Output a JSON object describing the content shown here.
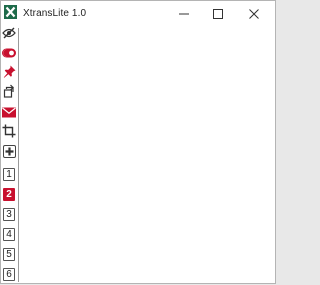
{
  "window": {
    "title": "XtransLite 1.0",
    "icon": "app-x-icon",
    "controls": [
      "minimize-icon",
      "maximize-icon",
      "close-icon"
    ]
  },
  "toolbar": {
    "icons": [
      "eye-off-icon",
      "toggle-icon",
      "pin-icon",
      "rotate-icon",
      "mail-icon",
      "crop-icon",
      "add-box-icon"
    ],
    "pages": [
      {
        "label": "1",
        "active": false
      },
      {
        "label": "2",
        "active": true
      },
      {
        "label": "3",
        "active": false
      },
      {
        "label": "4",
        "active": false
      },
      {
        "label": "5",
        "active": false
      },
      {
        "label": "6",
        "active": false
      }
    ]
  },
  "colors": {
    "accent": "#c8102e",
    "icon_dark": "#333333",
    "app_icon": "#1e6b4a"
  }
}
